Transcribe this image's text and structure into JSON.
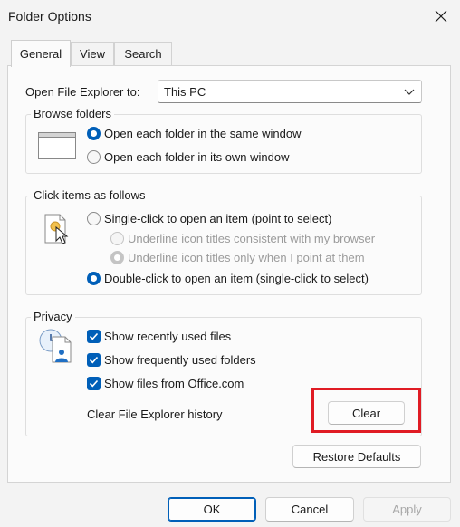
{
  "window": {
    "title": "Folder Options"
  },
  "tabs": [
    {
      "label": "General",
      "active": true
    },
    {
      "label": "View",
      "active": false
    },
    {
      "label": "Search",
      "active": false
    }
  ],
  "open_explorer": {
    "label": "Open File Explorer to:",
    "value": "This PC"
  },
  "browse": {
    "legend": "Browse folders",
    "opt_same": "Open each folder in the same window",
    "opt_own": "Open each folder in its own window",
    "selected": "same"
  },
  "click_items": {
    "legend": "Click items as follows",
    "single": "Single-click to open an item (point to select)",
    "underline_browser": "Underline icon titles consistent with my browser",
    "underline_point": "Underline icon titles only when I point at them",
    "double": "Double-click to open an item (single-click to select)",
    "selected": "double"
  },
  "privacy": {
    "legend": "Privacy",
    "recent": "Show recently used files",
    "frequent": "Show frequently used folders",
    "office": "Show files from Office.com",
    "clear_label": "Clear File Explorer history",
    "clear_button": "Clear"
  },
  "buttons": {
    "restore": "Restore Defaults",
    "ok": "OK",
    "cancel": "Cancel",
    "apply": "Apply"
  },
  "colors": {
    "accent": "#005fb8",
    "highlight": "#e01b24"
  }
}
